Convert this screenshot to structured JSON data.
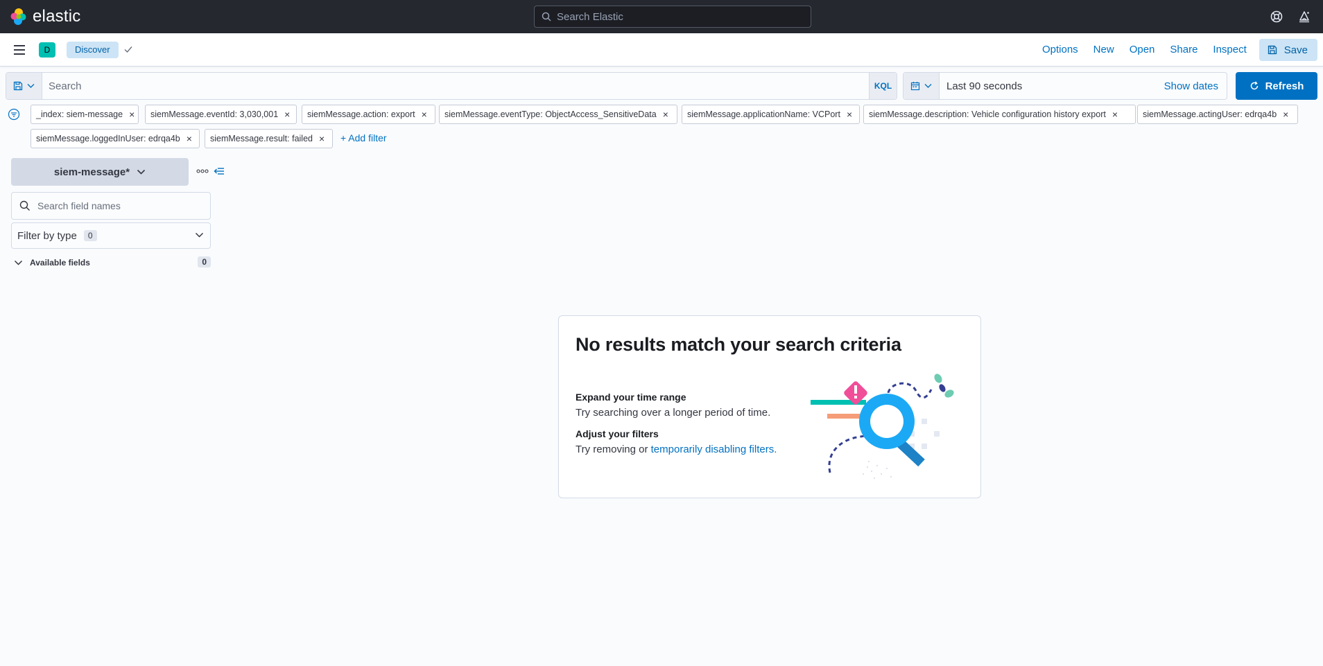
{
  "header": {
    "brand": "elastic",
    "search_placeholder": "Search Elastic",
    "icons": [
      "elastic-logo-icon",
      "search-icon",
      "help-icon",
      "news-feed-icon"
    ]
  },
  "app_bar": {
    "space_initial": "D",
    "breadcrumb": "Discover",
    "menu": {
      "options": "Options",
      "new": "New",
      "open": "Open",
      "share": "Share",
      "inspect": "Inspect",
      "save": "Save"
    }
  },
  "query_bar": {
    "placeholder": "Search",
    "language": "KQL",
    "date_range": "Last 90 seconds",
    "show_dates": "Show dates",
    "refresh": "Refresh"
  },
  "filters": [
    "_index: siem-message",
    "siemMessage.eventId: 3,030,001",
    "siemMessage.action: export",
    "siemMessage.eventType: ObjectAccess_SensitiveData",
    "siemMessage.applicationName: VCPort",
    "siemMessage.description: Vehicle configuration history export",
    "siemMessage.actingUser: edrqa4b",
    "siemMessage.loggedInUser: edrqa4b",
    "siemMessage.result: failed"
  ],
  "add_filter": "+ Add filter",
  "sidebar": {
    "index_pattern": "siem-message*",
    "field_search_placeholder": "Search field names",
    "filter_by_type": "Filter by type",
    "filter_count": "0",
    "available_fields": "Available fields",
    "available_count": "0"
  },
  "empty_state": {
    "title": "No results match your search criteria",
    "tip1_title": "Expand your time range",
    "tip1_text": "Try searching over a longer period of time.",
    "tip2_title": "Adjust your filters",
    "tip2_text_prefix": "Try removing or ",
    "tip2_link": "temporarily disabling filters."
  },
  "colors": {
    "header_bg": "#25282f",
    "accent": "#0071c2",
    "accent_light": "#cce4f5",
    "teal": "#00bfb3"
  }
}
